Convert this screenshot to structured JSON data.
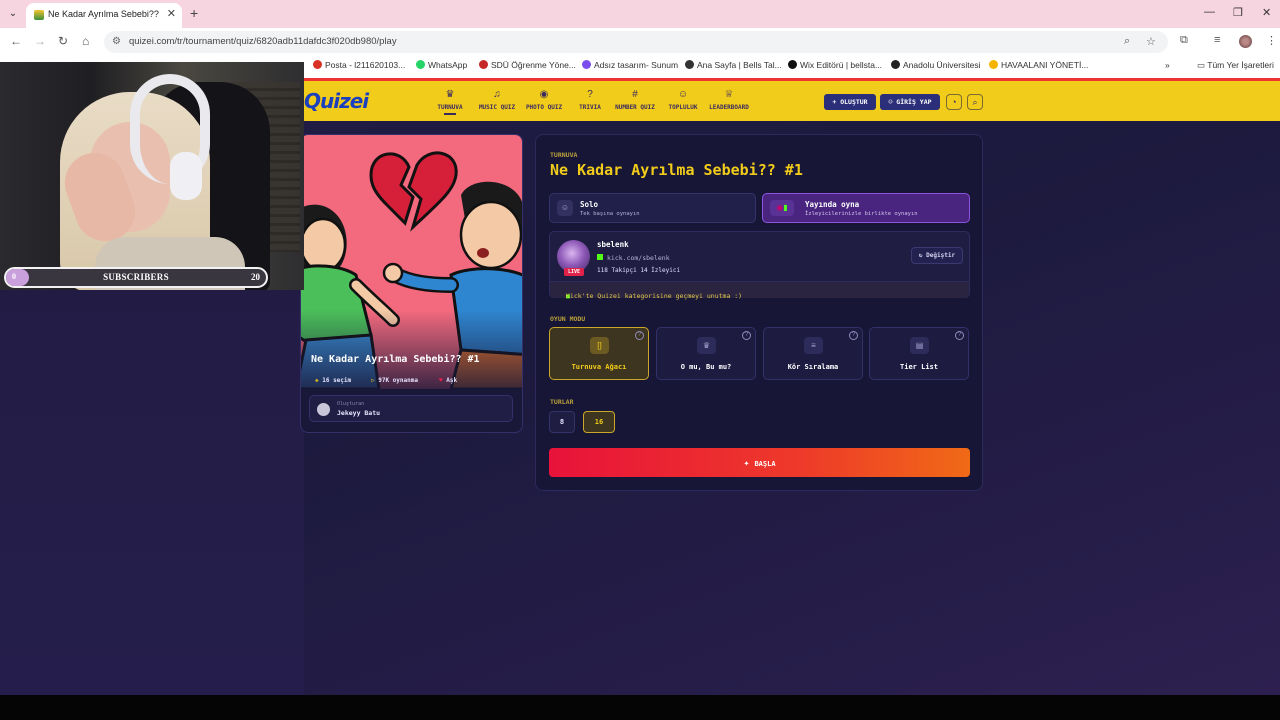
{
  "browser": {
    "tab_title": "Ne Kadar Ayrılma Sebebi?? #1",
    "url": "quizei.com/tr/tournament/quiz/6820adb11dafdc3f020db980/play",
    "bookmarks": [
      {
        "label": "Posta - l211620103...",
        "color": "#d93025"
      },
      {
        "label": "WhatsApp",
        "color": "#25d366"
      },
      {
        "label": "SDÜ Öğrenme Yöne...",
        "color": "#c62828"
      },
      {
        "label": "Adsız tasarım- Sunum",
        "color": "#7b4ef0"
      },
      {
        "label": "Ana Sayfa | Bells Tal...",
        "color": "#333333"
      },
      {
        "label": "Wix Editörü | bellsta...",
        "color": "#111111"
      },
      {
        "label": "Anadolu Üniversitesi",
        "color": "#222222"
      },
      {
        "label": "HAVAALANI YÖNETİ...",
        "color": "#f4b400"
      }
    ],
    "all_bookmarks": "Tüm Yer İşaretleri"
  },
  "site": {
    "logo": "Quizei",
    "nav": [
      {
        "label": "TURNUVA",
        "icon": "trophy-icon",
        "glyph": "♛"
      },
      {
        "label": "MUSIC QUIZ",
        "icon": "music-icon",
        "glyph": "♫"
      },
      {
        "label": "PHOTO QUIZ",
        "icon": "camera-icon",
        "glyph": "◉"
      },
      {
        "label": "TRIVIA",
        "icon": "question-icon",
        "glyph": "?"
      },
      {
        "label": "NUMBER QUIZ",
        "icon": "hash-icon",
        "glyph": "#"
      },
      {
        "label": "TOPLULUK",
        "icon": "users-icon",
        "glyph": "☺"
      },
      {
        "label": "LEADERBOARD",
        "icon": "medal-icon",
        "glyph": "♕"
      }
    ],
    "create_label": "OLUŞTUR",
    "login_label": "GİRİŞ YAP"
  },
  "quiz": {
    "title": "Ne Kadar Ayrılma Sebebi?? #1",
    "choices": "16 seçim",
    "plays": "97K oynanma",
    "category": "Aşk",
    "creator_label": "Oluşturan",
    "creator_name": "Jekeyy Batu"
  },
  "panel": {
    "kicker": "TURNUVA",
    "title": "Ne Kadar Ayrılma Sebebi?? #1",
    "solo": {
      "name": "Solo",
      "sub": "Tek başına oynayın"
    },
    "stream": {
      "name": "Yayında oyna",
      "sub": "İzleyicilerinizle birlikte oynayın"
    },
    "streamer": {
      "live": "LIVE",
      "name": "sbelenk",
      "link": "kick.com/sbelenk",
      "stats": "118 Takipçi  14 İzleyici",
      "change": "Değiştir",
      "note": "Kick'te Quizei kategorisine geçmeyi unutma :)"
    },
    "game_mode_label": "OYUN MODU",
    "game_modes": [
      {
        "label": "Turnuva Ağacı",
        "glyph": "[]"
      },
      {
        "label": "O mu, Bu mu?",
        "glyph": "♛"
      },
      {
        "label": "Kör Sıralama",
        "glyph": "≡"
      },
      {
        "label": "Tier List",
        "glyph": "▤"
      }
    ],
    "rounds_label": "TURLAR",
    "rounds": [
      "8",
      "16"
    ],
    "start_label": "BAŞLA"
  },
  "overlay": {
    "subs_start": "0",
    "subs_label": "SUBSCRIBERS",
    "subs_goal": "20",
    "subs_progress": 0.09
  },
  "colors": {
    "accent": "#f2cc1a",
    "brand": "#1a3fbf",
    "start_gradient": [
      "#e8123a",
      "#f06a16"
    ],
    "stream_mode": "#5b2d9a"
  }
}
